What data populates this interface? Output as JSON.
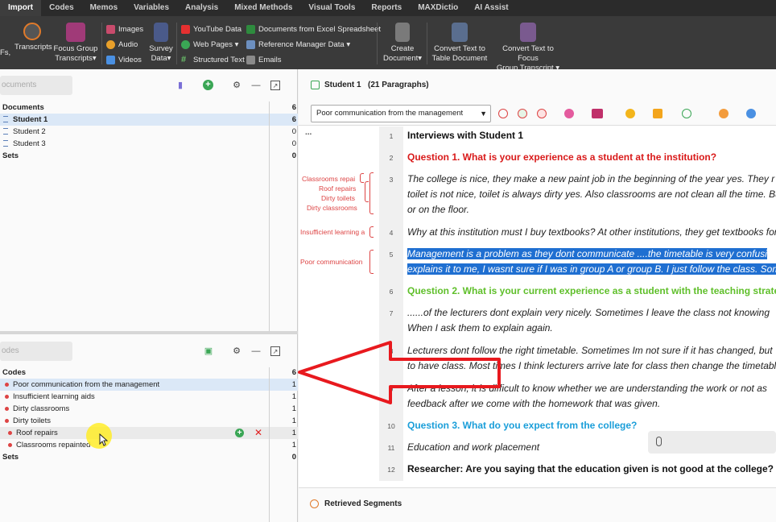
{
  "menu": {
    "tabs": [
      "Import",
      "Codes",
      "Memos",
      "Variables",
      "Analysis",
      "Mixed Methods",
      "Visual Tools",
      "Reports",
      "MAXDictio",
      "AI Assist"
    ],
    "active": "Import"
  },
  "ribbon": {
    "fs_partial": "Fs,",
    "transcripts": "Transcripts",
    "focus_group_1": "Focus Group",
    "focus_group_2": "Transcripts",
    "images": "Images",
    "audio": "Audio",
    "videos": "Videos",
    "survey_1": "Survey",
    "survey_2": "Data",
    "youtube": "YouTube Data",
    "webpages": "Web Pages",
    "structured": "Structured Text",
    "excel": "Documents from Excel Spreadsheet",
    "reference": "Reference Manager Data",
    "emails": "Emails",
    "create_1": "Create",
    "create_2": "Document",
    "convert_table_1": "Convert Text to",
    "convert_table_2": "Table Document",
    "convert_focus_1": "Convert Text to Focus",
    "convert_focus_2": "Group Transcript",
    "dropdown_glyph": "▾"
  },
  "documents_panel": {
    "search_placeholder": "ocuments",
    "rows": [
      {
        "label": "Documents",
        "count": "6"
      },
      {
        "label": "Student 1",
        "count": "6"
      },
      {
        "label": "Student 2",
        "count": "0"
      },
      {
        "label": "Student 3",
        "count": "0"
      },
      {
        "label": "Sets",
        "count": "0"
      }
    ]
  },
  "codes_panel": {
    "search_placeholder": "odes",
    "rows": [
      {
        "label": "Codes",
        "count": "6"
      },
      {
        "label": "Poor communication from the management",
        "count": "1"
      },
      {
        "label": "Insufficient learning aids",
        "count": "1"
      },
      {
        "label": "Dirty classrooms",
        "count": "1"
      },
      {
        "label": "Dirty toilets",
        "count": "1"
      },
      {
        "label": "Roof repairs",
        "count": "1"
      },
      {
        "label": "Classrooms repainted",
        "count": "1"
      },
      {
        "label": "Sets",
        "count": "0"
      }
    ]
  },
  "document_view": {
    "title": "Student 1",
    "paragraphs_info": "(21 Paragraphs)",
    "selected_code": "Poor communication from the management",
    "ellipsis": "...",
    "coding_labels": [
      "Classrooms repai",
      "Roof repairs",
      "Dirty toilets",
      "Dirty classrooms",
      "Insufficient learning a",
      "Poor communication"
    ],
    "paragraphs": [
      {
        "num": "1",
        "lines": [
          "Interviews with Student 1"
        ]
      },
      {
        "num": "2",
        "lines": [
          "Question 1. What is your experience as a student at the institution?"
        ]
      },
      {
        "num": "3",
        "lines": [
          "The college is nice, they make a new paint job in the beginning of the year yes. They r",
          "toilet is not nice, toilet is always dirty yes. Also classrooms are not clean all the time. Bu",
          "or on the floor."
        ]
      },
      {
        "num": "4",
        "lines": [
          "Why at this institution must I buy textbooks? At other institutions, they get textbooks for f"
        ]
      },
      {
        "num": "5",
        "lines": [
          " Management is a problem as they dont communicate ....the timetable is very confusi",
          "explains it to me, I wasnt sure if I was in group A or group B. I just follow the class. Some"
        ]
      },
      {
        "num": "6",
        "lines": [
          "Question 2. What is your current experience as a student with the teaching strate"
        ]
      },
      {
        "num": "7",
        "lines": [
          "......of the lecturers dont explain very nicely. Sometimes I leave the class not knowing",
          "When I ask them to explain again."
        ]
      },
      {
        "num": "8",
        "lines": [
          "Lecturers dont follow the right timetable. Sometimes Im not sure if it has changed, but",
          "to have class. Most times I think lecturers arrive late for class then change the timetable"
        ]
      },
      {
        "num": "9",
        "lines": [
          "After a lesson, it is difficult to know whether we are understanding the work or not as",
          "feedback after we come with the homework that was given."
        ]
      },
      {
        "num": "10",
        "lines": [
          "Question 3. What do you expect from the college?"
        ]
      },
      {
        "num": "11",
        "lines": [
          "Education and work placement"
        ]
      },
      {
        "num": "12",
        "lines": [
          "Researcher: Are you saying that the education given is not good at the college?"
        ]
      }
    ]
  },
  "retrieved_segments": "Retrieved Segments",
  "colors": {
    "accent_red": "#d91a1a",
    "q2_green": "#5fbf2a",
    "q3_blue": "#1a9ed9",
    "selection_blue": "#1f6fd1",
    "code_dot": "#dd4444",
    "annotation_arrow": "#e8191e"
  }
}
